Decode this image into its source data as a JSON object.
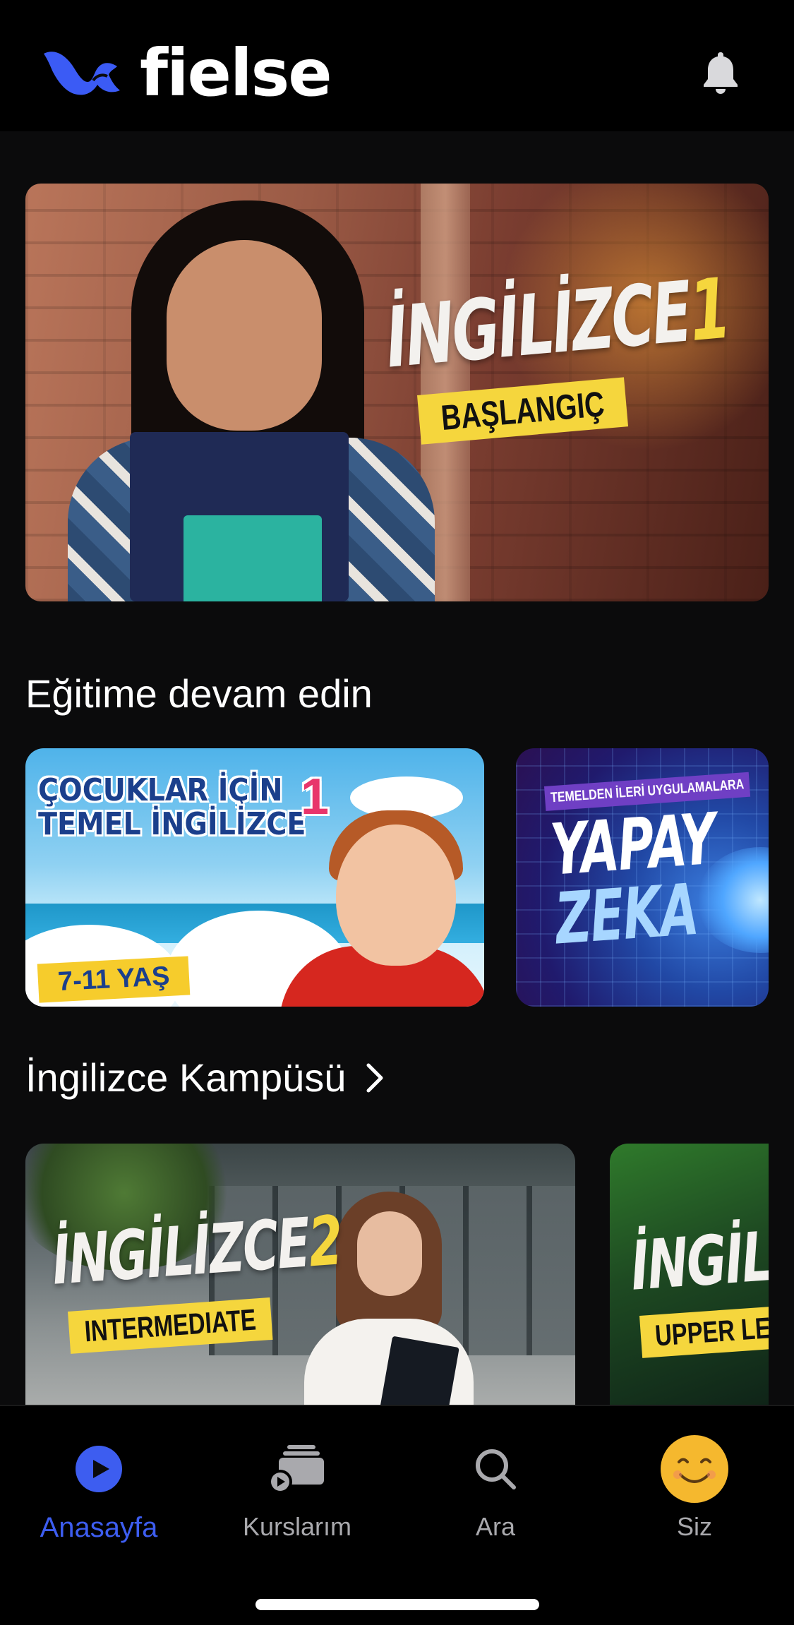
{
  "header": {
    "brand_name": "fielse",
    "brand_color": "#3b5bf5",
    "notifications_icon": "bell-icon"
  },
  "hero": {
    "title": "İNGİLİZCE",
    "number": "1",
    "subtitle": "BAŞLANGIÇ",
    "carousel_pages": 2,
    "active_page": 1
  },
  "continue_section": {
    "title": "Eğitime devam edin",
    "cards": [
      {
        "title_line1": "ÇOCUKLAR İÇİN",
        "title_line2": "TEMEL İNGİLİZCE",
        "number": "1",
        "tag": "7-11 YAŞ"
      },
      {
        "kicker": "TEMELDEN İLERİ UYGULAMALARA",
        "title_line1": "YAPAY",
        "title_line2": "ZEKA"
      }
    ]
  },
  "campus_section": {
    "title": "İngilizce Kampüsü",
    "chevron_icon": "chevron-right-icon",
    "cards": [
      {
        "title": "İNGİLİZCE",
        "number": "2",
        "subtitle": "INTERMEDIATE"
      },
      {
        "title": "İNGİLİ",
        "subtitle": "UPPER LEVE"
      }
    ]
  },
  "bottom_nav": {
    "items": [
      {
        "label": "Anasayfa",
        "icon": "play-circle-icon",
        "active": true
      },
      {
        "label": "Kurslarım",
        "icon": "courses-stack-icon",
        "active": false
      },
      {
        "label": "Ara",
        "icon": "search-icon",
        "active": false
      },
      {
        "label": "Siz",
        "icon": "smiley-avatar-icon",
        "active": false
      }
    ],
    "active_color": "#3d5df0",
    "inactive_color": "#a9a9ad"
  }
}
